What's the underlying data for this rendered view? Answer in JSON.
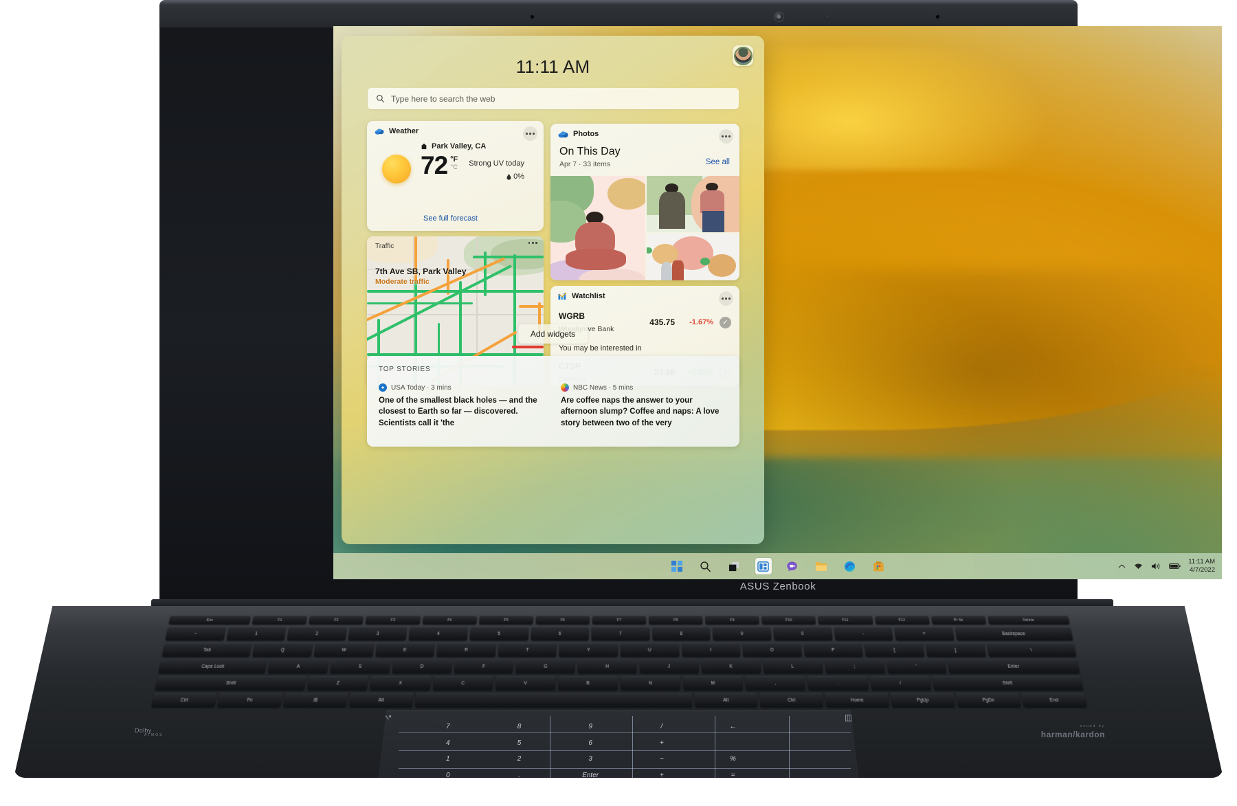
{
  "device": {
    "brand_label": "ASUS Zenbook",
    "audio_left": {
      "name": "Dolby",
      "sub": "ATMOS"
    },
    "audio_right": {
      "sub": "sound by",
      "name": "harman/kardon"
    }
  },
  "widgets": {
    "clock": "11:11 AM",
    "avatar_name": "user-avatar",
    "search": {
      "placeholder": "Type here to search the web",
      "icon": "search-icon"
    },
    "add_widgets_label": "Add widgets",
    "weather": {
      "title": "Weather",
      "icon": "weather-cloud-icon",
      "location": "Park Valley, CA",
      "location_icon": "home-icon",
      "temperature": "72",
      "unit_primary": "°F",
      "unit_secondary": "°C",
      "uv": "Strong UV today",
      "precipitation": "0%",
      "precip_icon": "raindrop-icon",
      "link": "See full forecast",
      "more_icon": "more-options-icon"
    },
    "traffic": {
      "title": "Traffic",
      "street": "7th Ave SB, Park Valley",
      "status": "Moderate traffic",
      "status_color": "#c8761b",
      "more_icon": "more-options-icon"
    },
    "photos": {
      "title": "Photos",
      "icon": "onedrive-cloud-icon",
      "headline": "On This Day",
      "subtitle": "Apr 7  ·  33 items",
      "see_all": "See all",
      "more_icon": "more-options-icon"
    },
    "watchlist": {
      "title": "Watchlist",
      "icon": "stocks-chart-icon",
      "more_icon": "more-options-icon",
      "interest_label": "You may be interested in",
      "rows": [
        {
          "symbol": "WGRB",
          "name": "Woodgrove Bank",
          "price": "435.75",
          "change": "-1.67%",
          "direction": "negative",
          "action_icon": "check-icon"
        },
        {
          "symbol": "CTSP",
          "name": "Contoso",
          "price": "23.98",
          "change": "+2.23%",
          "direction": "positive",
          "action_icon": "plus-icon"
        }
      ]
    },
    "top_stories": {
      "section_label": "TOP STORIES",
      "items": [
        {
          "source": "USA Today · 3 mins",
          "source_icon": "usa-today-icon",
          "source_color": "#1a73c8",
          "headline": "One of the smallest black holes — and the closest to Earth so far — discovered. Scientists call it 'the"
        },
        {
          "source": "NBC News · 5 mins",
          "source_icon": "nbc-news-icon",
          "source_color": "#d14d2a",
          "headline": "Are coffee naps the answer to your afternoon slump? Coffee and naps: A love story between two of the very"
        }
      ]
    }
  },
  "taskbar": {
    "items": [
      {
        "name": "start-button",
        "icon": "windows-logo-icon"
      },
      {
        "name": "search-button",
        "icon": "search-icon"
      },
      {
        "name": "task-view-button",
        "icon": "task-view-icon"
      },
      {
        "name": "widgets-button",
        "icon": "widgets-icon",
        "active": true
      },
      {
        "name": "chat-button",
        "icon": "chat-icon"
      },
      {
        "name": "file-explorer-button",
        "icon": "folder-icon"
      },
      {
        "name": "edge-button",
        "icon": "edge-icon"
      },
      {
        "name": "store-button",
        "icon": "microsoft-store-icon"
      }
    ],
    "tray": {
      "chevron_icon": "chevron-up-icon",
      "wifi_icon": "wifi-icon",
      "volume_icon": "speaker-icon",
      "battery_icon": "battery-icon",
      "time": "11:11 AM",
      "date": "4/7/2022"
    }
  },
  "keyboard": {
    "fn_row": [
      "Esc",
      "F1",
      "F2",
      "F3",
      "F4",
      "F5",
      "F6",
      "F7",
      "F8",
      "F9",
      "F10",
      "F11",
      "F12",
      "Pr Sc",
      "Delete"
    ],
    "row1": [
      "~",
      "1",
      "2",
      "3",
      "4",
      "5",
      "6",
      "7",
      "8",
      "9",
      "0",
      "-",
      "=",
      "Backspace"
    ],
    "row2": [
      "Tab",
      "Q",
      "W",
      "E",
      "R",
      "T",
      "Y",
      "U",
      "I",
      "O",
      "P",
      "[",
      "]",
      "\\"
    ],
    "row3": [
      "Caps Lock",
      "A",
      "S",
      "D",
      "F",
      "G",
      "H",
      "J",
      "K",
      "L",
      ";",
      "'",
      "Enter"
    ],
    "row4": [
      "Shift",
      "Z",
      "X",
      "C",
      "V",
      "B",
      "N",
      "M",
      ",",
      ".",
      "/",
      "Shift"
    ],
    "row5": [
      "Ctrl",
      "Fn",
      "⊞",
      "Alt",
      "",
      "Alt",
      "Ctrl",
      "Home",
      "PgUp",
      "PgDn",
      "End"
    ]
  },
  "numberpad": {
    "toggle_icon": "numberpad-toggle-icon",
    "calculator_icon": "calculator-icon",
    "keys": [
      [
        "7",
        "8",
        "9",
        "/",
        "←",
        ""
      ],
      [
        "4",
        "5",
        "6",
        "+",
        "",
        ""
      ],
      [
        "1",
        "2",
        "3",
        "−",
        "%",
        ""
      ],
      [
        "0",
        ".",
        "Enter",
        "+",
        "=",
        ""
      ]
    ]
  }
}
